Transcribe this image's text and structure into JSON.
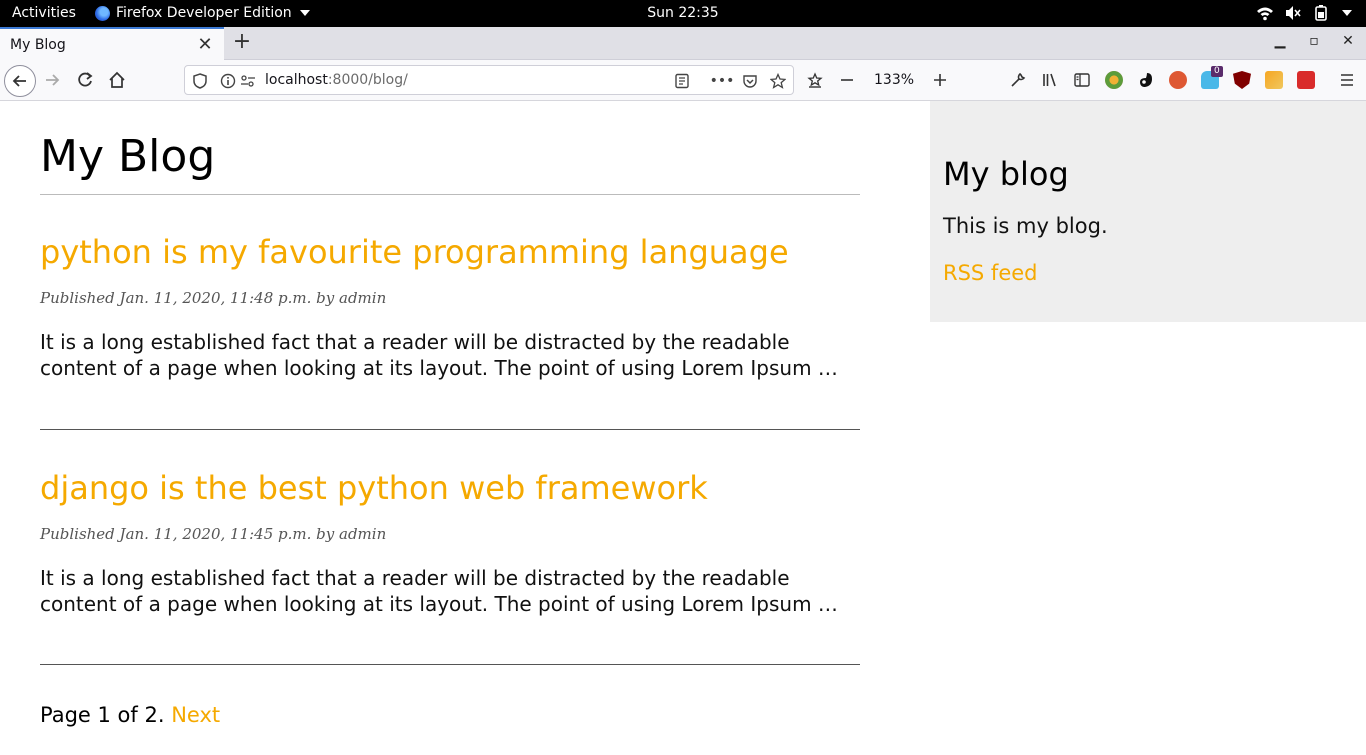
{
  "system": {
    "activities": "Activities",
    "app_name": "Firefox Developer Edition",
    "clock": "Sun 22:35"
  },
  "browser": {
    "tab_title": "My Blog",
    "url_host": "localhost",
    "url_rest": ":8000/blog/",
    "zoom": "133%",
    "notification_badge": "0"
  },
  "main": {
    "title": "My Blog",
    "posts": [
      {
        "title": "python is my favourite programming language",
        "meta": "Published Jan. 11, 2020, 11:48 p.m. by admin",
        "excerpt": "It is a long established fact that a reader will be distracted by the readable content of a page when looking at its layout. The point of using Lorem Ipsum …"
      },
      {
        "title": "django is the best python web framework",
        "meta": "Published Jan. 11, 2020, 11:45 p.m. by admin",
        "excerpt": "It is a long established fact that a reader will be distracted by the readable content of a page when looking at its layout. The point of using Lorem Ipsum …"
      }
    ],
    "pagination": {
      "status": "Page 1 of 2.",
      "next": "Next"
    }
  },
  "sidebar": {
    "title": "My blog",
    "description": "This is my blog.",
    "rss_label": "RSS feed"
  },
  "colors": {
    "accent": "#f5a900",
    "sidebar_bg": "#eeeeee"
  }
}
